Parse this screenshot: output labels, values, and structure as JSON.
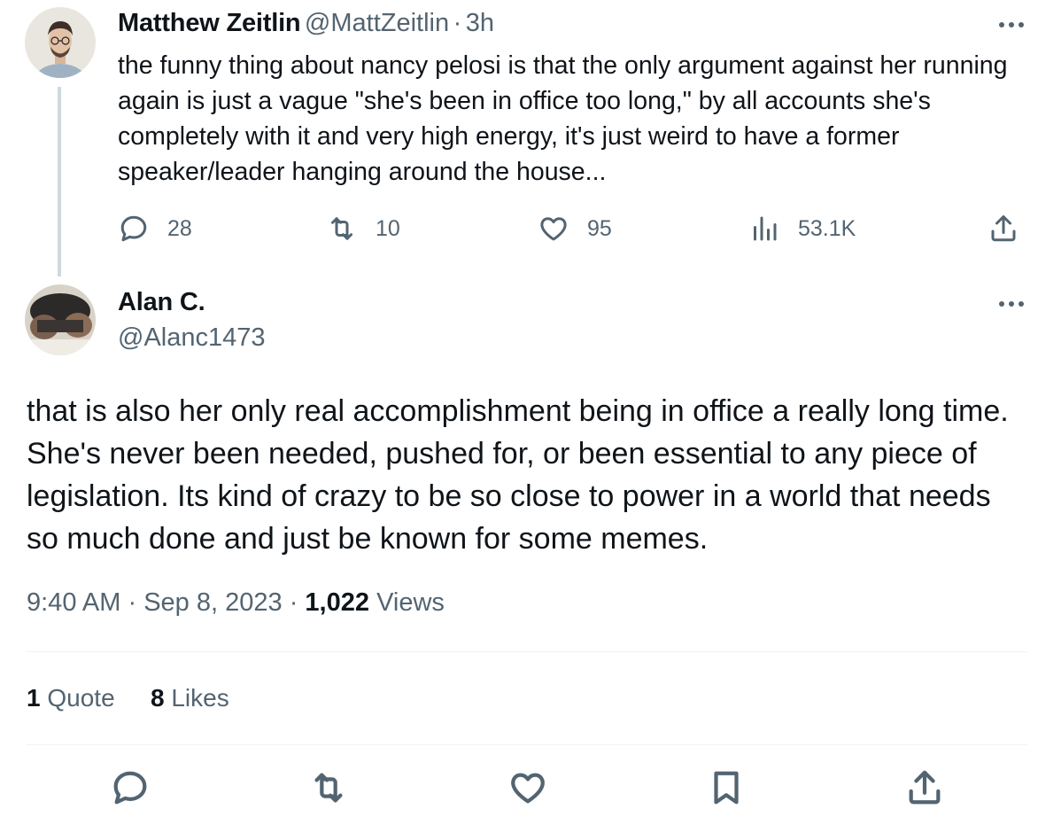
{
  "parent_tweet": {
    "author_name": "Matthew Zeitlin",
    "author_handle": "@MattZeitlin",
    "separator": "·",
    "time": "3h",
    "text": "the funny thing about nancy pelosi is that the only argument against her running again is just a vague \"she's been in office too long,\" by all accounts she's completely with it and very high energy, it's just weird to have a former speaker/leader hanging around the house...",
    "replies": "28",
    "retweets": "10",
    "likes": "95",
    "views": "53.1K"
  },
  "main_tweet": {
    "author_name": "Alan C.",
    "author_handle": "@Alanc1473",
    "text": "that is also her only real accomplishment being in office a really long time. She's never been needed, pushed for,  or been essential to any piece of legislation. Its kind of crazy to be so close to power in a world that needs so much done and just be known for some memes.",
    "time": "9:40 AM",
    "dot1": "·",
    "date": "Sep 8, 2023",
    "dot2": "·",
    "views_count": "1,022",
    "views_label": "Views",
    "quotes_count": "1",
    "quotes_label": "Quote",
    "likes_count": "8",
    "likes_label": "Likes"
  },
  "icons": {
    "reply": "reply-icon",
    "retweet": "retweet-icon",
    "like": "heart-icon",
    "views": "views-bar-icon",
    "share": "share-icon",
    "bookmark": "bookmark-icon",
    "more": "more-dots-icon"
  },
  "colors": {
    "text": "#0f1419",
    "secondary": "#536471",
    "divider": "#eff3f4",
    "thread_line": "#cfd9de"
  }
}
